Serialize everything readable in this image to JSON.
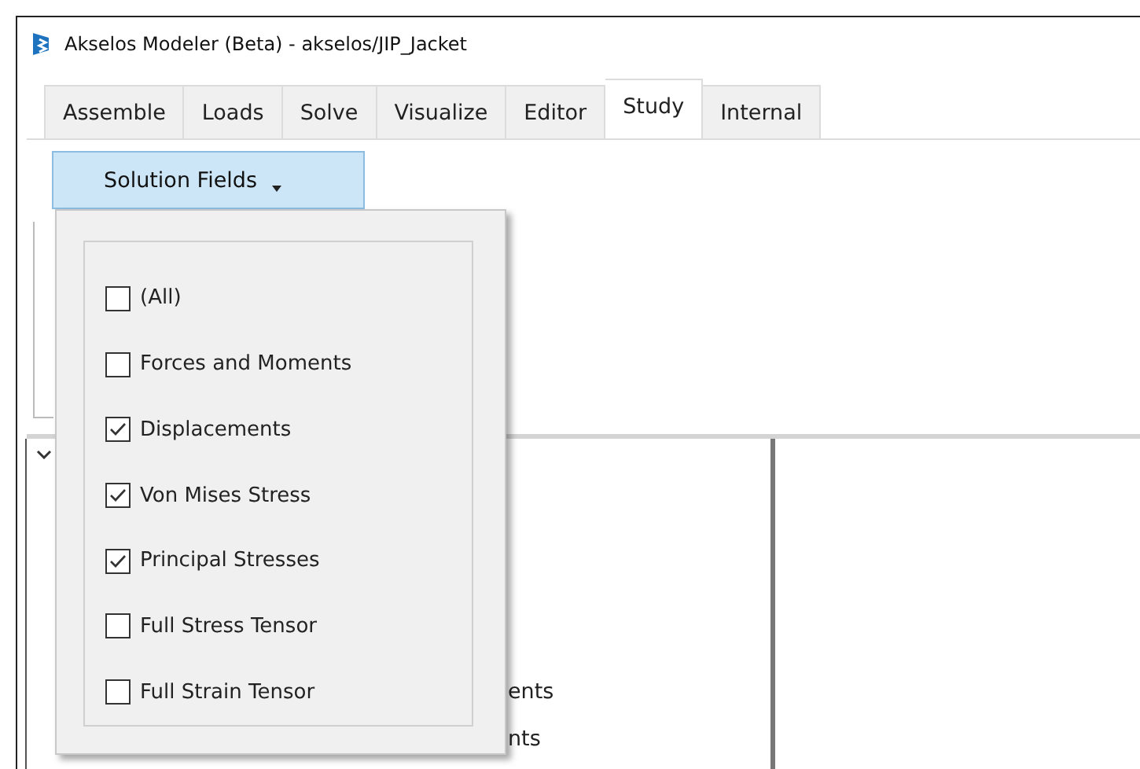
{
  "window": {
    "title": "Akselos Modeler (Beta) - akselos/JIP_Jacket"
  },
  "tabs": [
    {
      "label": "Assemble",
      "selected": false
    },
    {
      "label": "Loads",
      "selected": false
    },
    {
      "label": "Solve",
      "selected": false
    },
    {
      "label": "Visualize",
      "selected": false
    },
    {
      "label": "Editor",
      "selected": false
    },
    {
      "label": "Study",
      "selected": true
    },
    {
      "label": "Internal",
      "selected": false
    }
  ],
  "ribbon": {
    "dropdown_button": {
      "label": "Solution Fields",
      "expanded": true
    }
  },
  "dropdown_menu": {
    "items": [
      {
        "label": "(All)",
        "checked": false
      },
      {
        "label": "Forces and Moments",
        "checked": false
      },
      {
        "label": "Displacements",
        "checked": true
      },
      {
        "label": "Von Mises Stress",
        "checked": true
      },
      {
        "label": "Principal Stresses",
        "checked": true
      },
      {
        "label": "Full Stress Tensor",
        "checked": false
      },
      {
        "label": "Full Strain Tensor",
        "checked": false
      }
    ]
  },
  "tree": {
    "items": [
      "ents",
      "nts"
    ]
  }
}
